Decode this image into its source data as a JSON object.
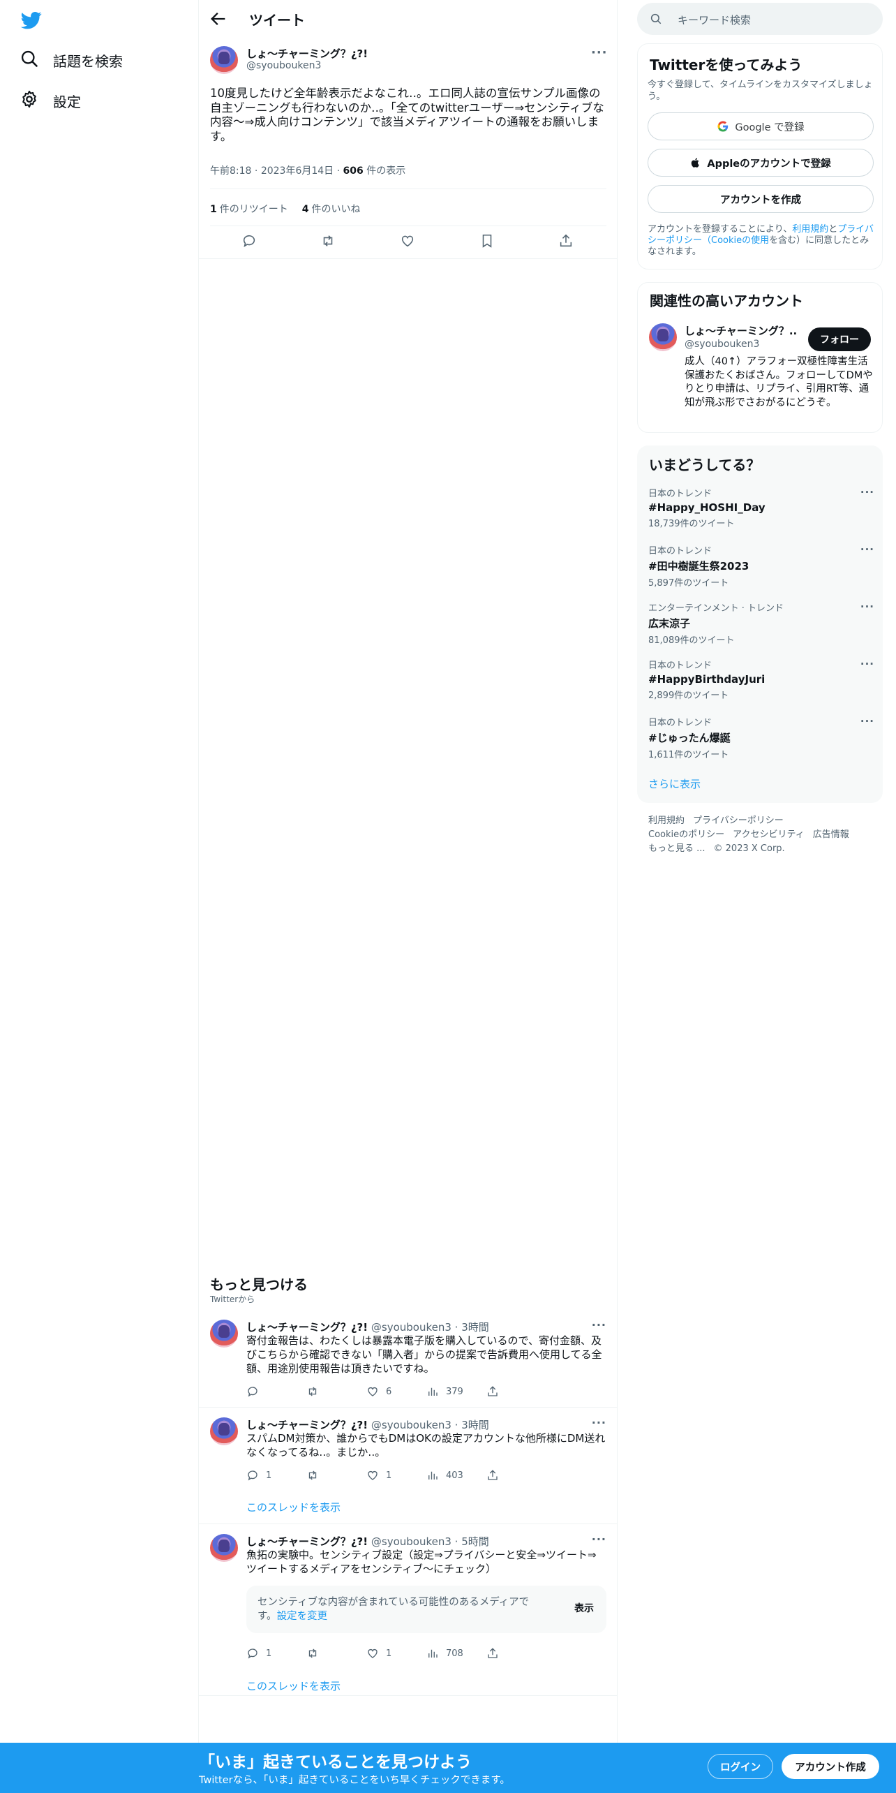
{
  "nav": {
    "items": [
      {
        "label": "話題を検索",
        "icon": "search-icon"
      },
      {
        "label": "設定",
        "icon": "gear-icon"
      }
    ]
  },
  "header": {
    "title": "ツイート"
  },
  "tweet": {
    "name": "しょ〜チャーミング？¿?!",
    "handle": "@syoubouken3",
    "text": "10度見したけど全年齢表示だよなこれ‥。エロ同人誌の宣伝サンプル画像の自主ゾーニングも行わないのか‥。「全てのtwitterユーザー⇒センシティブな内容〜⇒成人向けコンテンツ」で該当メディアツイートの通報をお願いします。",
    "time": "午前8:18",
    "date": "2023年6月14日",
    "views_count": "606",
    "views_label": "件の表示",
    "retweets_count": "1",
    "retweets_label": "件のリツイート",
    "likes_count": "4",
    "likes_label": "件のいいね"
  },
  "discover": {
    "title": "もっと見つける",
    "subtitle": "Twitterから"
  },
  "related_tweets": [
    {
      "name": "しょ〜チャーミング？¿?!",
      "handle": "@syoubouken3",
      "time": "3時間",
      "text": "寄付金報告は、わたくしは暴露本電子版を購入しているので、寄付金額、及びこちらから確認できない「購入者」からの提案で告訴費用へ使用してる全額、用途別使用報告は頂きたいですね。",
      "replies": "",
      "retweets": "",
      "likes": "6",
      "views": "379"
    },
    {
      "name": "しょ〜チャーミング？¿?!",
      "handle": "@syoubouken3",
      "time": "3時間",
      "text": "スパムDM対策か、誰からでもDMはOKの設定アカウントな他所様にDM送れなくなってるね‥。まじか‥。",
      "replies": "1",
      "retweets": "",
      "likes": "1",
      "views": "403",
      "thread_link": "このスレッドを表示"
    },
    {
      "name": "しょ〜チャーミング？¿?!",
      "handle": "@syoubouken3",
      "time": "5時間",
      "text": "魚拓の実験中。センシティブ設定（設定⇒プライバシーと安全⇒ツイート⇒ツイートするメディアをセンシティブ〜にチェック）",
      "sensitive_text": "センシティブな内容が含まれている可能性のあるメディアです。",
      "sensitive_link": "設定を変更",
      "sensitive_show": "表示",
      "replies": "1",
      "retweets": "",
      "likes": "1",
      "views": "708",
      "thread_link": "このスレッドを表示"
    }
  ],
  "search": {
    "placeholder": "キーワード検索"
  },
  "signup_card": {
    "title": "Twitterを使ってみよう",
    "subtitle": "今すぐ登録して、タイムラインをカスタマイズしましょう。",
    "google_button": "Google で登録",
    "apple_button": "Appleのアカウントで登録",
    "create_button": "アカウントを作成",
    "legal_prefix": "アカウントを登録することにより、",
    "legal_terms": "利用規約",
    "legal_and": "と",
    "legal_privacy": "プライバシーポリシー（Cookieの使用",
    "legal_suffix": "を含む）に同意したとみなされます。"
  },
  "related_accounts": {
    "title": "関連性の高いアカウント",
    "name": "しょ〜チャーミング？...",
    "handle": "@syoubouken3",
    "follow_button": "フォロー",
    "bio": "成人（40↑）アラフォー双極性障害生活保護おたくおばさん。フォローしてDMやりとり申請は、リプライ、引用RT等、通知が飛ぶ形でさおがるにどうぞ。"
  },
  "trends": {
    "title": "いまどうしてる？",
    "items": [
      {
        "category": "日本のトレンド",
        "name": "#Happy_HOSHI_Day",
        "count": "18,739件のツイート"
      },
      {
        "category": "日本のトレンド",
        "name": "#田中樹誕生祭2023",
        "count": "5,897件のツイート"
      },
      {
        "category": "エンターテインメント · トレンド",
        "name": "広末涼子",
        "count": "81,089件のツイート"
      },
      {
        "category": "日本のトレンド",
        "name": "#HappyBirthdayJuri",
        "count": "2,899件のツイート"
      },
      {
        "category": "日本のトレンド",
        "name": "#じゅったん爆誕",
        "count": "1,611件のツイート"
      }
    ],
    "show_more": "さらに表示"
  },
  "footer": {
    "links": [
      "利用規約",
      "プライバシーポリシー",
      "Cookieのポリシー",
      "アクセシビリティ",
      "広告情報",
      "もっと見る ...",
      "© 2023 X Corp."
    ]
  },
  "bottom_bar": {
    "title": "「いま」起きていることを見つけよう",
    "subtitle": "Twitterなら、「いま」起きていることをいち早くチェックできます。",
    "login": "ログイン",
    "signup": "アカウント作成"
  },
  "colors": {
    "accent": "#1d9bf0",
    "text": "#0f1419",
    "muted": "#536471"
  }
}
